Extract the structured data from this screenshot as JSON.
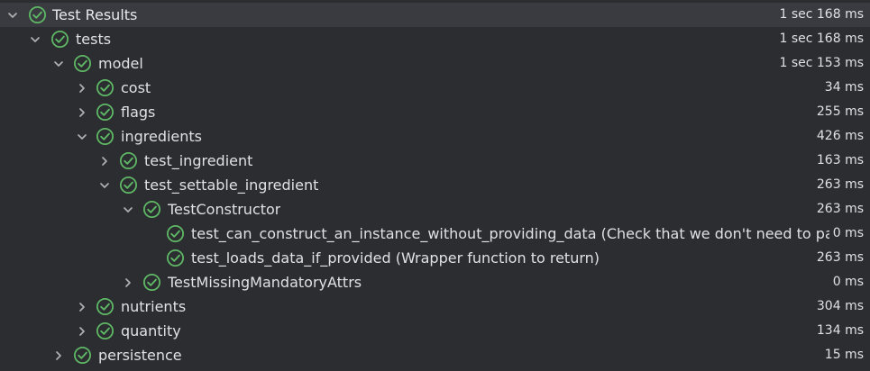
{
  "colors": {
    "background": "#2b2d30",
    "selected_row": "#393b40",
    "pass_green": "#5fb865",
    "text": "#dfe1e5",
    "chevron": "#afb1b3"
  },
  "icons": {
    "expanded": "chevron-down-icon",
    "collapsed": "chevron-right-icon",
    "status": "test-passed-icon"
  },
  "tree": [
    {
      "label": "Test Results",
      "duration": "1 sec 168 ms"
    },
    {
      "label": "tests",
      "duration": "1 sec 168 ms"
    },
    {
      "label": "model",
      "duration": "1 sec 153 ms"
    },
    {
      "label": "cost",
      "duration": "34 ms"
    },
    {
      "label": "flags",
      "duration": "255 ms"
    },
    {
      "label": "ingredients",
      "duration": "426 ms"
    },
    {
      "label": "test_ingredient",
      "duration": "163 ms"
    },
    {
      "label": "test_settable_ingredient",
      "duration": "263 ms"
    },
    {
      "label": "TestConstructor",
      "duration": "263 ms"
    },
    {
      "label": "test_can_construct_an_instance_without_providing_data (Check that we don't need to pass",
      "duration": "0 ms"
    },
    {
      "label": "test_loads_data_if_provided (Wrapper function to return)",
      "duration": "263 ms"
    },
    {
      "label": "TestMissingMandatoryAttrs",
      "duration": "0 ms"
    },
    {
      "label": "nutrients",
      "duration": "304 ms"
    },
    {
      "label": "quantity",
      "duration": "134 ms"
    },
    {
      "label": "persistence",
      "duration": "15 ms"
    }
  ]
}
